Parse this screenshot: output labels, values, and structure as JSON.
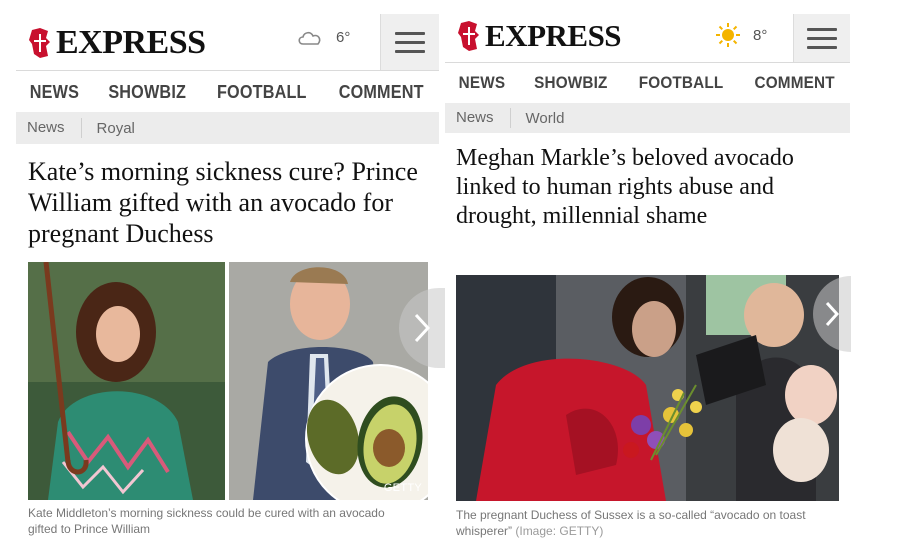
{
  "left": {
    "logo_text": "EXPRESS",
    "weather": {
      "icon": "cloud-icon",
      "temp": "6°"
    },
    "nav": [
      "NEWS",
      "SHOWBIZ",
      "FOOTBALL",
      "COMMENT"
    ],
    "breadcrumbs": [
      "News",
      "Royal"
    ],
    "headline": "Kate’s morning sickness cure? Prince William gifted with an avocado for pregnant Duchess",
    "image_credit": "GETTY",
    "caption": "Kate Middleton’s morning sickness could be cured with an avocado gifted to Prince William"
  },
  "right": {
    "logo_text": "EXPRESS",
    "weather": {
      "icon": "sun-icon",
      "temp": "8°"
    },
    "nav": [
      "NEWS",
      "SHOWBIZ",
      "FOOTBALL",
      "COMMENT"
    ],
    "breadcrumbs": [
      "News",
      "World"
    ],
    "headline": "Meghan Markle’s beloved avocado linked to human rights abuse and drought, millennial shame",
    "caption": "The pregnant Duchess of Sussex is a so-called “avocado on toast whisperer”",
    "caption_credit": "(Image: GETTY)"
  },
  "colors": {
    "brand_red": "#c8102e",
    "nav_text": "#444444",
    "crumb_bg": "#ececec",
    "sun": "#f4b400"
  }
}
